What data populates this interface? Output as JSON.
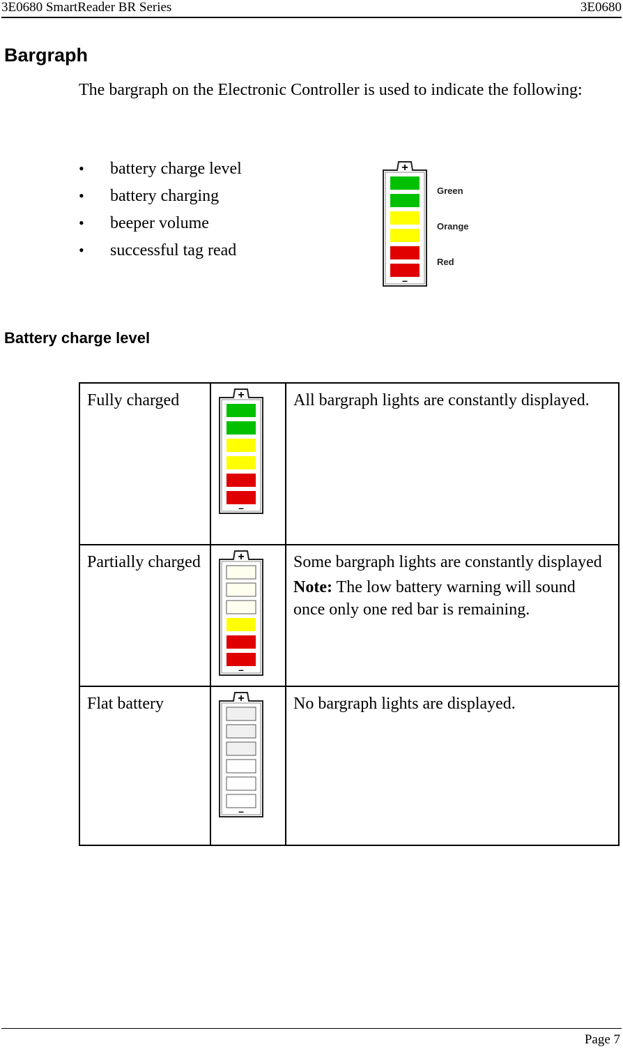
{
  "header": {
    "left": "3E0680 SmartReader BR Series",
    "right": "3E0680"
  },
  "section_title": "Bargraph",
  "intro": "The bargraph on the Electronic Controller is used to indicate the following:",
  "bullets": [
    "battery charge level",
    "battery charging",
    "beeper volume",
    "successful tag read"
  ],
  "bullet_glyph": "•",
  "legend": {
    "labels": [
      "Green",
      "Orange",
      "Red"
    ],
    "bars": [
      "#00c000",
      "#00c000",
      "#ffff00",
      "#ffff00",
      "#e00000",
      "#e00000"
    ]
  },
  "battery_icon": {
    "plus": "+",
    "minus": "–"
  },
  "subsection_title": "Battery charge level",
  "table": {
    "rows": [
      {
        "state": "Fully charged",
        "bars": [
          "#00c000",
          "#00c000",
          "#ffff00",
          "#ffff00",
          "#e00000",
          "#e00000"
        ],
        "description": "All bargraph lights are constantly displayed.",
        "note_label": "",
        "note": ""
      },
      {
        "state": "Partially charged",
        "bars": [
          "#fffff0",
          "#fffff0",
          "#fffff0",
          "#ffff00",
          "#e00000",
          "#e00000"
        ],
        "description": "Some bargraph lights are constantly displayed",
        "note_label": "Note:",
        "note": " The low battery warning will sound once only one red bar is remaining."
      },
      {
        "state": "Flat battery",
        "bars": [
          "#f0f0f0",
          "#f0f0f0",
          "#f0f0f0",
          "#ffffff",
          "#ffffff",
          "#ffffff"
        ],
        "description": "No bargraph lights are displayed.",
        "note_label": "",
        "note": ""
      }
    ]
  },
  "footer": {
    "page": "Page 7"
  }
}
